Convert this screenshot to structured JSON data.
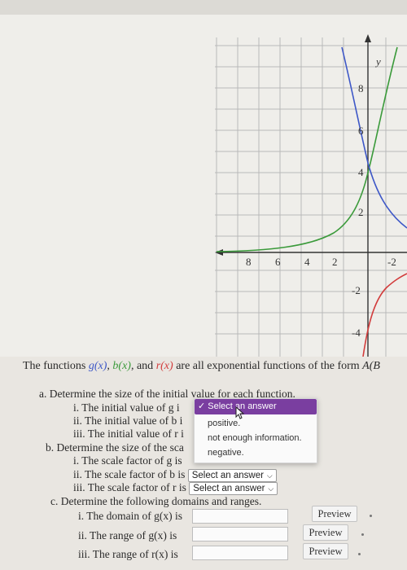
{
  "graph": {
    "x_tick_labels": [
      "8",
      "6",
      "4",
      "2",
      "-2"
    ],
    "y_tick_labels": [
      "8",
      "6",
      "4",
      "2",
      "-2",
      "-4"
    ],
    "y_axis_label": "y",
    "colors": {
      "g": "#3d57c7",
      "b": "#3a9a3a",
      "r": "#d23c3c",
      "axis": "#333333",
      "grid": "#b9b9b9"
    }
  },
  "question": {
    "intro_prefix": "The functions ",
    "fn_g": "g(x)",
    "fn_b": "b(x)",
    "fn_r": "r(x)",
    "sep1": ", ",
    "sep2": ", and ",
    "intro_suffix": " are all exponential functions of the form ",
    "intro_form": "A(B",
    "part_a": "a. Determine the size of the initial value for each function.",
    "a_i": "i. The initial value of g i",
    "a_ii": "ii. The initial value of b i",
    "a_iii": "iii. The initial value of r i",
    "part_b": "b. Determine the size of the sca",
    "b_i": "i. The scale factor of g is",
    "b_ii": "ii. The scale factor of b is",
    "b_iii": "iii. The scale factor of r is",
    "select_placeholder": "Select an answer",
    "part_c": "c. Determine the following domains and ranges.",
    "c_i": "i. The domain of g(x) is",
    "c_ii": "ii. The range of g(x) is",
    "c_iii": "iii. The range of r(x) is",
    "preview_label": "Preview"
  },
  "dropdown": {
    "selected": "✓ Select an answer",
    "options": [
      "positive.",
      "not enough information.",
      "negative."
    ]
  }
}
